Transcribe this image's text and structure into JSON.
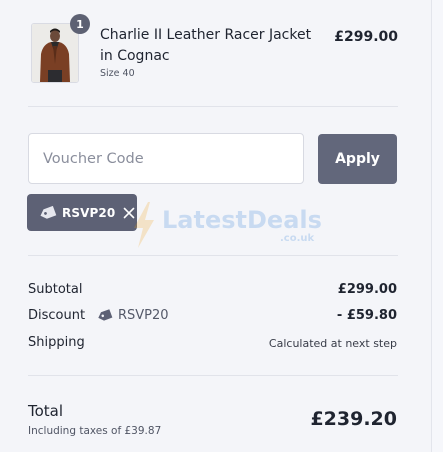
{
  "product": {
    "quantity": "1",
    "name": "Charlie II Leather Racer Jacket in Cognac",
    "variant": "Size 40",
    "price": "£299.00"
  },
  "voucher": {
    "placeholder": "Voucher Code",
    "value": "",
    "apply_label": "Apply",
    "applied_code": "RSVP20"
  },
  "watermark": {
    "brand": "LatestDeals",
    "domain": ".co.uk"
  },
  "summary": {
    "subtotal_label": "Subtotal",
    "subtotal_value": "£299.00",
    "discount_label": "Discount",
    "discount_code": "RSVP20",
    "discount_value": "- £59.80",
    "shipping_label": "Shipping",
    "shipping_value": "Calculated at next step",
    "total_label": "Total",
    "tax_note": "Including taxes of £39.87",
    "total_value": "£239.20"
  },
  "colors": {
    "panel_bg": "#f4f5f9",
    "button_bg": "#62677b",
    "chip_bg": "#5d6175",
    "text": "#1f2430"
  },
  "icons": [
    "product-thumbnail-image",
    "tag-icon",
    "close-icon",
    "lightning-bolt-icon"
  ]
}
